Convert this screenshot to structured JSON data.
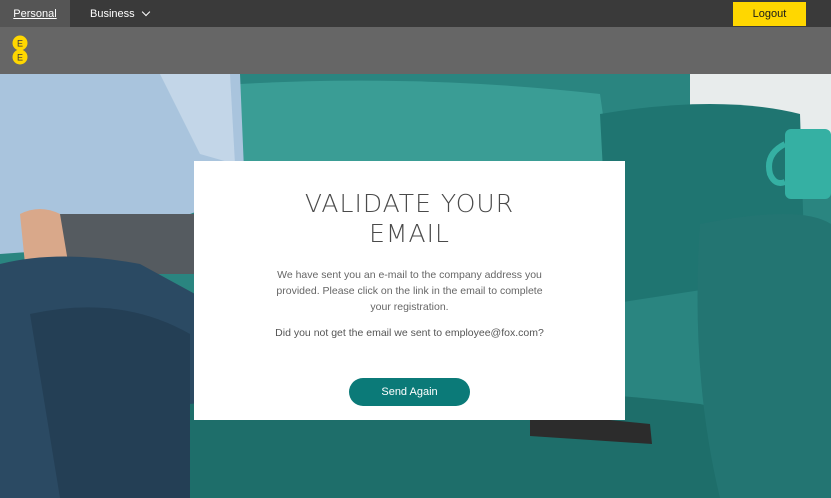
{
  "topbar": {
    "personal_label": "Personal",
    "business_label": "Business",
    "logout_label": "Logout"
  },
  "brand": {
    "logo_letters": "EE",
    "accent_color": "#ffd700"
  },
  "card": {
    "title": "VALIDATE YOUR\nEMAIL",
    "message": "We have sent you an e-mail to the company address you provided. Please click on the link in the email to complete your registration.",
    "question": "Did you not get the email we sent to employee@fox.com?",
    "button_label": "Send Again",
    "button_color": "#0b7a78"
  },
  "icons": [
    "chevron-down-icon",
    "ee-logo-icon"
  ]
}
